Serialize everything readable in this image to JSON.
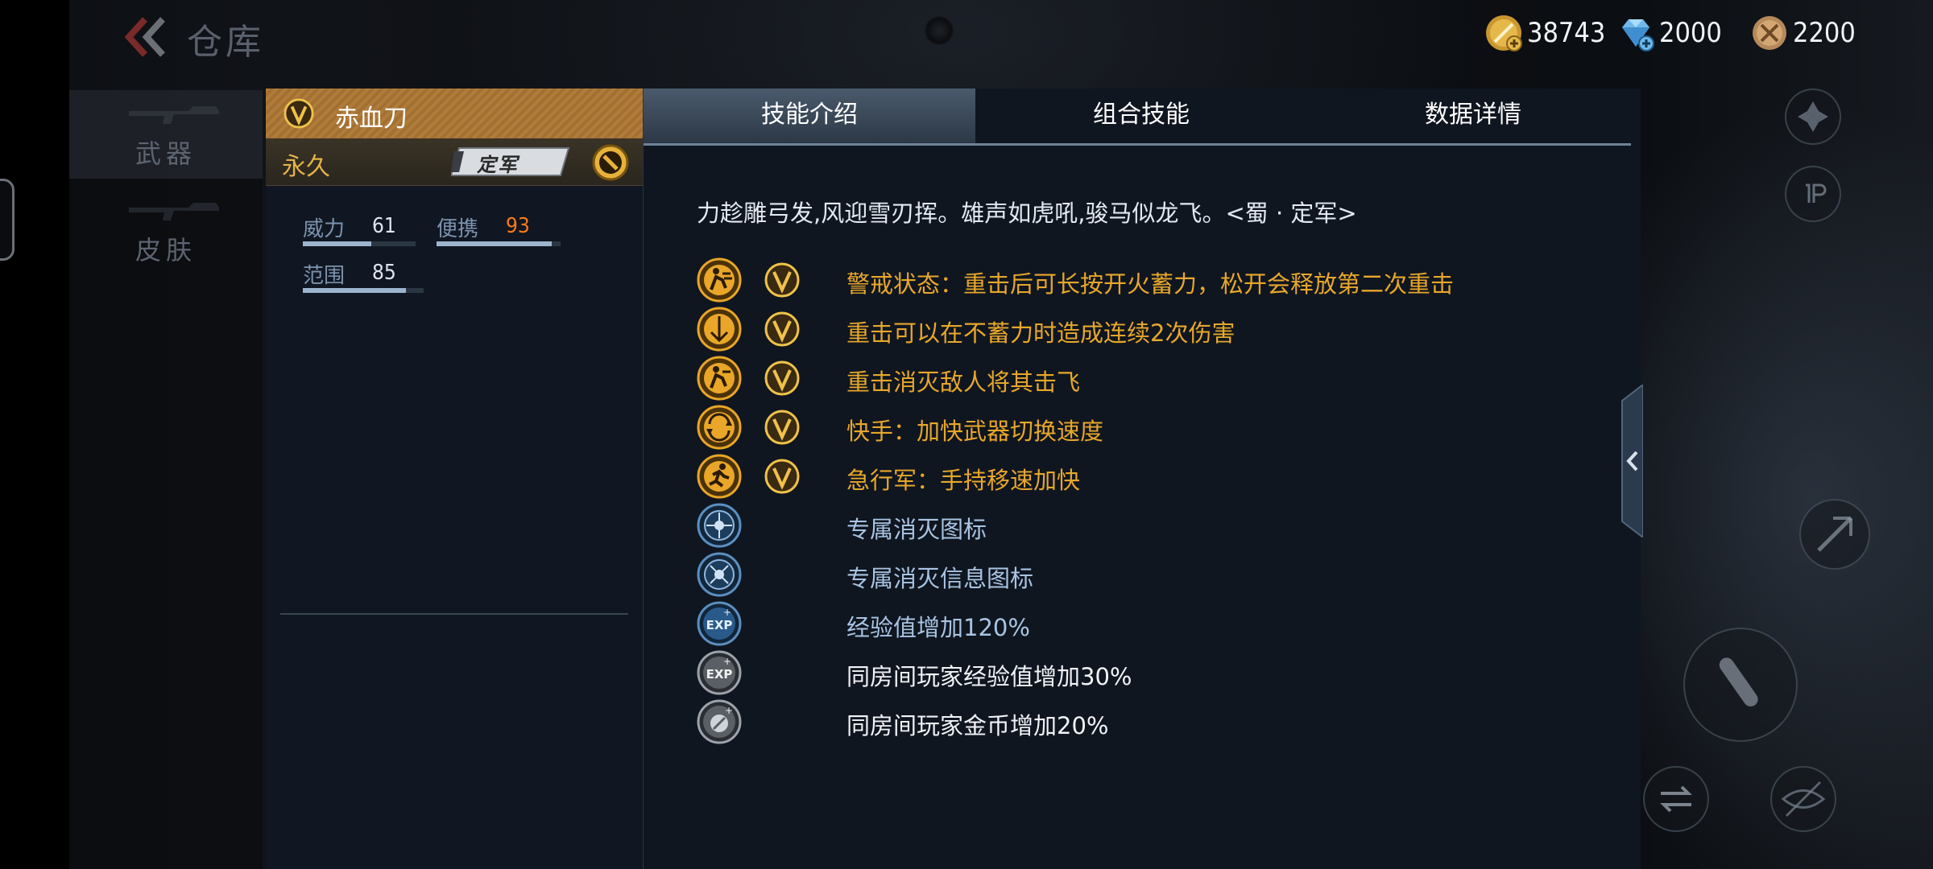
{
  "header": {
    "title": "仓库"
  },
  "currencies": [
    {
      "icon": "gold-coin-icon",
      "value": "38743"
    },
    {
      "icon": "diamond-icon",
      "value": "2000"
    },
    {
      "icon": "honor-coin-icon",
      "value": "2200"
    }
  ],
  "nav": {
    "items": [
      {
        "label": "武器"
      },
      {
        "label": "皮肤"
      }
    ]
  },
  "weapon": {
    "name": "赤血刀",
    "duration": "永久",
    "rank_label": "定军",
    "stats": [
      {
        "label": "威力",
        "value": "61",
        "fill": 0.61
      },
      {
        "label": "便携",
        "value": "93",
        "fill": 0.93
      },
      {
        "label": "范围",
        "value": "85",
        "fill": 0.85
      }
    ]
  },
  "tabs": [
    {
      "label": "技能介绍"
    },
    {
      "label": "组合技能"
    },
    {
      "label": "数据详情"
    }
  ],
  "active_tab": 0,
  "description": "力趁雕弓发,风迎雪刃挥。雄声如虎吼,骏马似龙飞。<蜀 · 定军>",
  "skills": [
    {
      "icon": "heavy-strike-icon",
      "text": "警戒状态：重击后可长按开火蓄力，松开会释放第二次重击"
    },
    {
      "icon": "double-damage-icon",
      "text": "重击可以在不蓄力时造成连续2次伤害"
    },
    {
      "icon": "knockback-icon",
      "text": "重击消灭敌人将其击飞"
    },
    {
      "icon": "quick-switch-icon",
      "text": "快手：加快武器切换速度"
    },
    {
      "icon": "sprint-icon",
      "text": "急行军：手持移速加快"
    },
    {
      "icon": "kill-icon",
      "text": "专属消灭图标"
    },
    {
      "icon": "kill-info-icon",
      "text": "专属消灭信息图标"
    },
    {
      "icon": "exp-icon",
      "text": "经验值增加120%"
    },
    {
      "icon": "room-exp-icon",
      "text": "同房间玩家经验值增加30%"
    },
    {
      "icon": "room-coin-icon",
      "text": "同房间玩家金币增加20%"
    }
  ],
  "colors": {
    "gold_text": "#e8a72a",
    "blue_text": "#a9c4e2",
    "highlight_value": "#ff7a1a"
  }
}
